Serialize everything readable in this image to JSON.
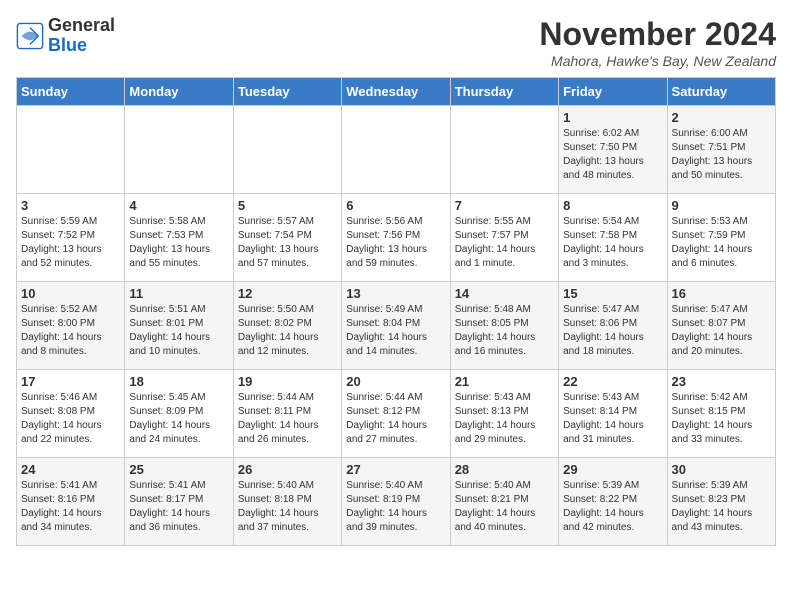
{
  "logo": {
    "general": "General",
    "blue": "Blue"
  },
  "title": {
    "month_year": "November 2024",
    "location": "Mahora, Hawke's Bay, New Zealand"
  },
  "weekdays": [
    "Sunday",
    "Monday",
    "Tuesday",
    "Wednesday",
    "Thursday",
    "Friday",
    "Saturday"
  ],
  "weeks": [
    [
      {
        "day": "",
        "detail": ""
      },
      {
        "day": "",
        "detail": ""
      },
      {
        "day": "",
        "detail": ""
      },
      {
        "day": "",
        "detail": ""
      },
      {
        "day": "",
        "detail": ""
      },
      {
        "day": "1",
        "detail": "Sunrise: 6:02 AM\nSunset: 7:50 PM\nDaylight: 13 hours and 48 minutes."
      },
      {
        "day": "2",
        "detail": "Sunrise: 6:00 AM\nSunset: 7:51 PM\nDaylight: 13 hours and 50 minutes."
      }
    ],
    [
      {
        "day": "3",
        "detail": "Sunrise: 5:59 AM\nSunset: 7:52 PM\nDaylight: 13 hours and 52 minutes."
      },
      {
        "day": "4",
        "detail": "Sunrise: 5:58 AM\nSunset: 7:53 PM\nDaylight: 13 hours and 55 minutes."
      },
      {
        "day": "5",
        "detail": "Sunrise: 5:57 AM\nSunset: 7:54 PM\nDaylight: 13 hours and 57 minutes."
      },
      {
        "day": "6",
        "detail": "Sunrise: 5:56 AM\nSunset: 7:56 PM\nDaylight: 13 hours and 59 minutes."
      },
      {
        "day": "7",
        "detail": "Sunrise: 5:55 AM\nSunset: 7:57 PM\nDaylight: 14 hours and 1 minute."
      },
      {
        "day": "8",
        "detail": "Sunrise: 5:54 AM\nSunset: 7:58 PM\nDaylight: 14 hours and 3 minutes."
      },
      {
        "day": "9",
        "detail": "Sunrise: 5:53 AM\nSunset: 7:59 PM\nDaylight: 14 hours and 6 minutes."
      }
    ],
    [
      {
        "day": "10",
        "detail": "Sunrise: 5:52 AM\nSunset: 8:00 PM\nDaylight: 14 hours and 8 minutes."
      },
      {
        "day": "11",
        "detail": "Sunrise: 5:51 AM\nSunset: 8:01 PM\nDaylight: 14 hours and 10 minutes."
      },
      {
        "day": "12",
        "detail": "Sunrise: 5:50 AM\nSunset: 8:02 PM\nDaylight: 14 hours and 12 minutes."
      },
      {
        "day": "13",
        "detail": "Sunrise: 5:49 AM\nSunset: 8:04 PM\nDaylight: 14 hours and 14 minutes."
      },
      {
        "day": "14",
        "detail": "Sunrise: 5:48 AM\nSunset: 8:05 PM\nDaylight: 14 hours and 16 minutes."
      },
      {
        "day": "15",
        "detail": "Sunrise: 5:47 AM\nSunset: 8:06 PM\nDaylight: 14 hours and 18 minutes."
      },
      {
        "day": "16",
        "detail": "Sunrise: 5:47 AM\nSunset: 8:07 PM\nDaylight: 14 hours and 20 minutes."
      }
    ],
    [
      {
        "day": "17",
        "detail": "Sunrise: 5:46 AM\nSunset: 8:08 PM\nDaylight: 14 hours and 22 minutes."
      },
      {
        "day": "18",
        "detail": "Sunrise: 5:45 AM\nSunset: 8:09 PM\nDaylight: 14 hours and 24 minutes."
      },
      {
        "day": "19",
        "detail": "Sunrise: 5:44 AM\nSunset: 8:11 PM\nDaylight: 14 hours and 26 minutes."
      },
      {
        "day": "20",
        "detail": "Sunrise: 5:44 AM\nSunset: 8:12 PM\nDaylight: 14 hours and 27 minutes."
      },
      {
        "day": "21",
        "detail": "Sunrise: 5:43 AM\nSunset: 8:13 PM\nDaylight: 14 hours and 29 minutes."
      },
      {
        "day": "22",
        "detail": "Sunrise: 5:43 AM\nSunset: 8:14 PM\nDaylight: 14 hours and 31 minutes."
      },
      {
        "day": "23",
        "detail": "Sunrise: 5:42 AM\nSunset: 8:15 PM\nDaylight: 14 hours and 33 minutes."
      }
    ],
    [
      {
        "day": "24",
        "detail": "Sunrise: 5:41 AM\nSunset: 8:16 PM\nDaylight: 14 hours and 34 minutes."
      },
      {
        "day": "25",
        "detail": "Sunrise: 5:41 AM\nSunset: 8:17 PM\nDaylight: 14 hours and 36 minutes."
      },
      {
        "day": "26",
        "detail": "Sunrise: 5:40 AM\nSunset: 8:18 PM\nDaylight: 14 hours and 37 minutes."
      },
      {
        "day": "27",
        "detail": "Sunrise: 5:40 AM\nSunset: 8:19 PM\nDaylight: 14 hours and 39 minutes."
      },
      {
        "day": "28",
        "detail": "Sunrise: 5:40 AM\nSunset: 8:21 PM\nDaylight: 14 hours and 40 minutes."
      },
      {
        "day": "29",
        "detail": "Sunrise: 5:39 AM\nSunset: 8:22 PM\nDaylight: 14 hours and 42 minutes."
      },
      {
        "day": "30",
        "detail": "Sunrise: 5:39 AM\nSunset: 8:23 PM\nDaylight: 14 hours and 43 minutes."
      }
    ]
  ]
}
